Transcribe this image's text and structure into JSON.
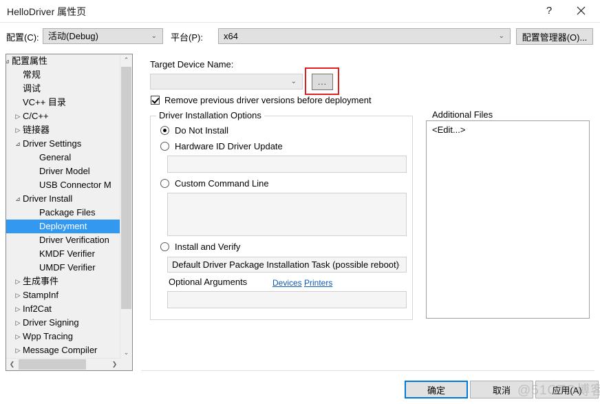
{
  "window": {
    "title": "HelloDriver 属性页",
    "help_label": "?",
    "close_label": "✕"
  },
  "config_bar": {
    "config_label": "配置(C):",
    "config_value": "活动(Debug)",
    "platform_label": "平台(P):",
    "platform_value": "x64",
    "config_manager_label": "配置管理器(O)...",
    "dropdown_arrow": "⌄"
  },
  "tree": {
    "selected": "Deployment",
    "selection_color": "#3399f0",
    "items": [
      {
        "label": "配置属性",
        "indent": 0,
        "expander": "⊿"
      },
      {
        "label": "常规",
        "indent": 1,
        "expander": ""
      },
      {
        "label": "调试",
        "indent": 1,
        "expander": ""
      },
      {
        "label": "VC++ 目录",
        "indent": 1,
        "expander": ""
      },
      {
        "label": "C/C++",
        "indent": 1,
        "expander": "▷"
      },
      {
        "label": "链接器",
        "indent": 1,
        "expander": "▷"
      },
      {
        "label": "Driver Settings",
        "indent": 1,
        "expander": "⊿"
      },
      {
        "label": "General",
        "indent": 2,
        "expander": ""
      },
      {
        "label": "Driver Model",
        "indent": 2,
        "expander": ""
      },
      {
        "label": "USB Connector M",
        "indent": 2,
        "expander": ""
      },
      {
        "label": "Driver Install",
        "indent": 1,
        "expander": "⊿"
      },
      {
        "label": "Package Files",
        "indent": 2,
        "expander": ""
      },
      {
        "label": "Deployment",
        "indent": 2,
        "expander": "",
        "selected": true
      },
      {
        "label": "Driver Verification",
        "indent": 2,
        "expander": ""
      },
      {
        "label": "KMDF Verifier",
        "indent": 2,
        "expander": ""
      },
      {
        "label": "UMDF Verifier",
        "indent": 2,
        "expander": ""
      },
      {
        "label": "生成事件",
        "indent": 1,
        "expander": "▷"
      },
      {
        "label": "StampInf",
        "indent": 1,
        "expander": "▷"
      },
      {
        "label": "Inf2Cat",
        "indent": 1,
        "expander": "▷"
      },
      {
        "label": "Driver Signing",
        "indent": 1,
        "expander": "▷"
      },
      {
        "label": "Wpp Tracing",
        "indent": 1,
        "expander": "▷"
      },
      {
        "label": "Message Compiler",
        "indent": 1,
        "expander": "▷"
      }
    ],
    "scroll_up": "⌃",
    "scroll_down": "⌄",
    "scroll_left": "❮",
    "scroll_right": "❯"
  },
  "main": {
    "target_device_label": "Target Device Name:",
    "target_device_value": "",
    "target_device_arrow": "⌄",
    "browse_button_label": "...",
    "browse_highlight_color": "#e02020",
    "remove_previous_label": "Remove previous driver versions before deployment",
    "remove_previous_checked": true,
    "driver_install_group_title": "Driver Installation Options",
    "options": [
      {
        "label": "Do Not Install",
        "selected": true
      },
      {
        "label": "Hardware ID Driver Update",
        "selected": false
      },
      {
        "label": "Custom Command Line",
        "selected": false
      },
      {
        "label": "Install and Verify",
        "selected": false
      }
    ],
    "hardware_id_value": "",
    "custom_command_value": "",
    "install_task_value": "Default Driver Package Installation Task (possible reboot)",
    "install_task_arrow": "⌄",
    "optional_arguments_label": "Optional Arguments",
    "optional_arguments_value": "",
    "links": [
      {
        "label": "Devices"
      },
      {
        "label": "Printers"
      }
    ],
    "additional_files_group_title": "Additional Files",
    "additional_files_items": [
      "<Edit...>"
    ]
  },
  "footer": {
    "ok_label": "确定",
    "cancel_label": "取消",
    "apply_label": "应用(A)"
  },
  "watermark": {
    "text": "@51CTO博客"
  }
}
